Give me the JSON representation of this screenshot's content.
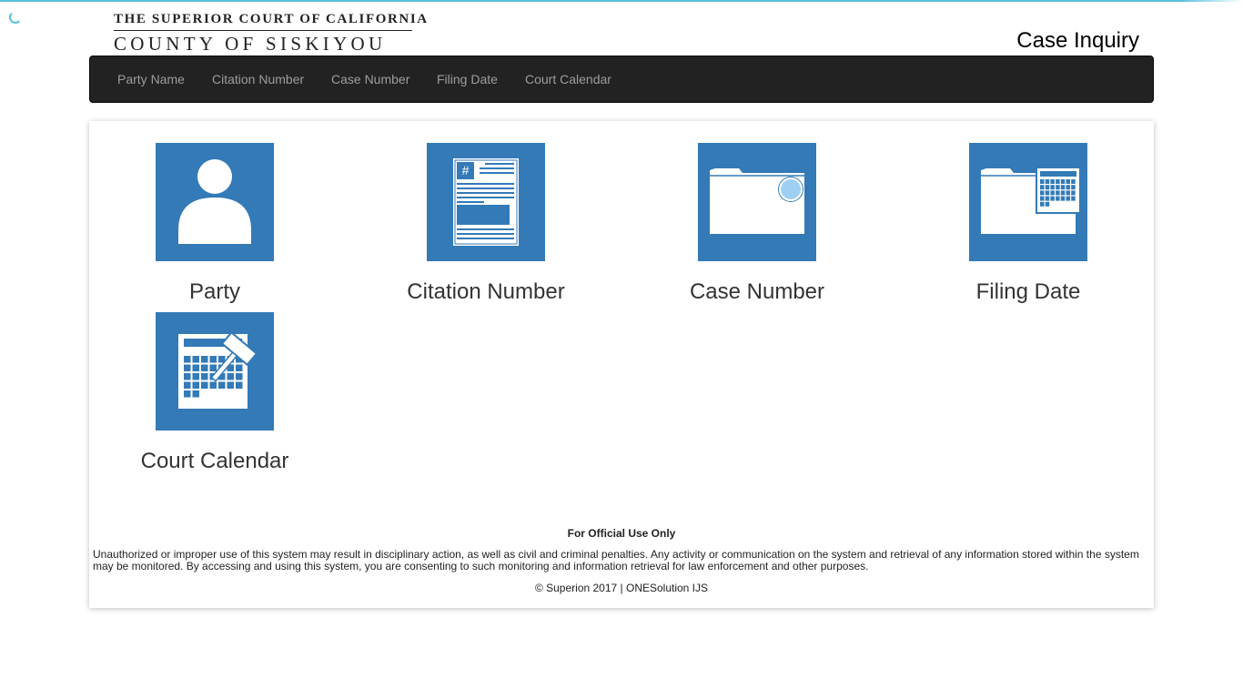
{
  "header": {
    "logo_line1": "THE SUPERIOR COURT OF CALIFORNIA",
    "logo_line2": "COUNTY OF SISKIYOU",
    "page_title": "Case Inquiry"
  },
  "nav": {
    "items": [
      {
        "label": "Party Name"
      },
      {
        "label": "Citation Number"
      },
      {
        "label": "Case Number"
      },
      {
        "label": "Filing Date"
      },
      {
        "label": "Court Calendar"
      }
    ]
  },
  "tiles": [
    {
      "label": "Party",
      "icon": "person-icon"
    },
    {
      "label": "Citation Number",
      "icon": "citation-document-icon"
    },
    {
      "label": "Case Number",
      "icon": "folder-search-icon"
    },
    {
      "label": "Filing Date",
      "icon": "folder-calendar-icon"
    },
    {
      "label": "Court Calendar",
      "icon": "calendar-gavel-icon"
    }
  ],
  "footer": {
    "official": "For Official Use Only",
    "warning": "Unauthorized or improper use of this system may result in disciplinary action, as well as civil and criminal penalties. Any activity or communication on the system and retrieval of any information stored within the system may be monitored. By accessing and using this system, you are consenting to such monitoring and information retrieval for law enforcement and other purposes.",
    "copyright": "© Superion 2017 | ONESolution IJS"
  },
  "colors": {
    "tile": "#337ab7",
    "navbar": "#222222",
    "nav_text": "#9d9d9d",
    "accent": "#5bc0de"
  }
}
